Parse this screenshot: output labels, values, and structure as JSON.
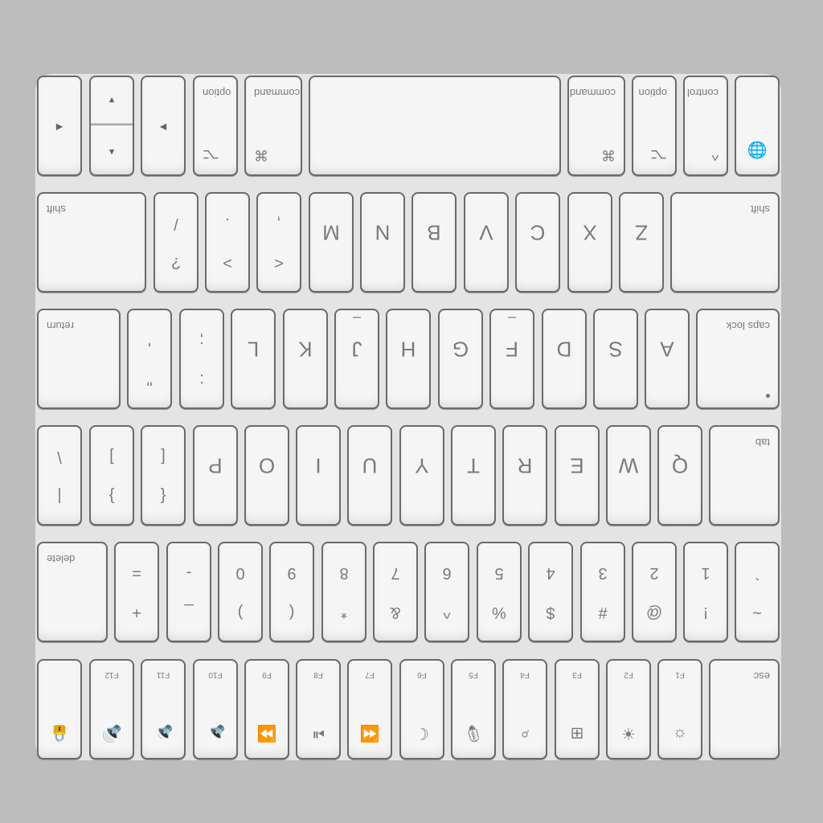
{
  "function_row": {
    "esc": "esc",
    "keys": [
      {
        "label": "F1",
        "icon": "☼",
        "icon_name": "brightness-down-icon"
      },
      {
        "label": "F2",
        "icon": "☀",
        "icon_name": "brightness-up-icon"
      },
      {
        "label": "F3",
        "icon": "⊞",
        "icon_name": "mission-control-icon"
      },
      {
        "label": "F4",
        "icon": "⌕",
        "icon_name": "spotlight-icon"
      },
      {
        "label": "F5",
        "icon": "🎙",
        "icon_name": "dictation-icon"
      },
      {
        "label": "F6",
        "icon": "☾",
        "icon_name": "do-not-disturb-icon"
      },
      {
        "label": "F7",
        "icon": "⏪",
        "icon_name": "rewind-icon"
      },
      {
        "label": "F8",
        "icon": "⏯",
        "icon_name": "play-pause-icon"
      },
      {
        "label": "F9",
        "icon": "⏩",
        "icon_name": "fast-forward-icon"
      },
      {
        "label": "F10",
        "icon": "🔈",
        "icon_name": "mute-icon"
      },
      {
        "label": "F11",
        "icon": "🔉",
        "icon_name": "volume-down-icon"
      },
      {
        "label": "F12",
        "icon": "🔊",
        "icon_name": "volume-up-icon"
      }
    ],
    "touch_id_icon": "lock-icon"
  },
  "number_row": {
    "keys": [
      {
        "upper": "~",
        "lower": "`"
      },
      {
        "upper": "!",
        "lower": "1"
      },
      {
        "upper": "@",
        "lower": "2"
      },
      {
        "upper": "#",
        "lower": "3"
      },
      {
        "upper": "$",
        "lower": "4"
      },
      {
        "upper": "%",
        "lower": "5"
      },
      {
        "upper": "^",
        "lower": "6"
      },
      {
        "upper": "&",
        "lower": "7"
      },
      {
        "upper": "*",
        "lower": "8"
      },
      {
        "upper": "(",
        "lower": "9"
      },
      {
        "upper": ")",
        "lower": "0"
      },
      {
        "upper": "_",
        "lower": "-"
      },
      {
        "upper": "+",
        "lower": "="
      }
    ],
    "delete": "delete"
  },
  "qwerty_row": {
    "tab": "tab",
    "letters": [
      "Q",
      "W",
      "E",
      "R",
      "T",
      "Y",
      "U",
      "I",
      "O",
      "P"
    ],
    "brackets": [
      {
        "upper": "{",
        "lower": "["
      },
      {
        "upper": "}",
        "lower": "]"
      },
      {
        "upper": "|",
        "lower": "\\"
      }
    ]
  },
  "home_row": {
    "caps": "caps lock",
    "letters": [
      "A",
      "S",
      "D",
      "F",
      "G",
      "H",
      "J",
      "K",
      "L"
    ],
    "punct": [
      {
        "upper": ":",
        "lower": ";"
      },
      {
        "upper": "\"",
        "lower": "'"
      }
    ],
    "return": "return"
  },
  "bottom_letter_row": {
    "shift_left": "shift",
    "letters": [
      "Z",
      "X",
      "C",
      "V",
      "B",
      "N",
      "M"
    ],
    "punct": [
      {
        "upper": "<",
        "lower": ","
      },
      {
        "upper": ">",
        "lower": "."
      },
      {
        "upper": "?",
        "lower": "/"
      }
    ],
    "shift_right": "shift"
  },
  "modifier_row": {
    "fn_icon": "globe-icon",
    "control": "control",
    "control_sym": "^",
    "option_left": "option",
    "option_sym": "⌥",
    "command_left": "command",
    "command_sym": "⌘",
    "command_right": "command",
    "option_right": "option",
    "arrows": {
      "left": "◀",
      "up": "▲",
      "down": "▼",
      "right": "▶"
    }
  },
  "colors": {
    "background": "#bdbdbe",
    "key": "#f5f5f5",
    "legend": "#7a7a7a"
  }
}
